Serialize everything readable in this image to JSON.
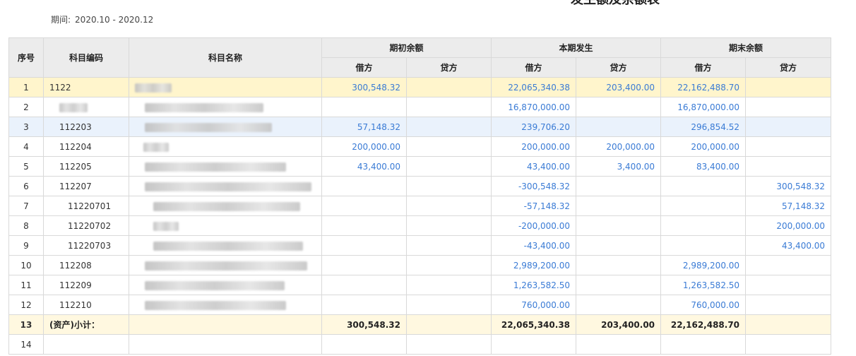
{
  "report": {
    "title": "发生额及余额表",
    "period_label": "期间:",
    "period_value": "2020.10 - 2020.12"
  },
  "columns": {
    "index": "序号",
    "code": "科目编码",
    "name": "科目名称",
    "groups": [
      "期初余额",
      "本期发生",
      "期末余额"
    ],
    "debit": "借方",
    "credit": "贷方"
  },
  "rows": [
    {
      "idx": "1",
      "code": "1122",
      "open_debit": "300,548.32",
      "open_credit": "",
      "period_debit": "22,065,340.38",
      "period_credit": "203,400.00",
      "close_debit": "22,162,488.70",
      "close_credit": ""
    },
    {
      "idx": "2",
      "code": "",
      "open_debit": "",
      "open_credit": "",
      "period_debit": "16,870,000.00",
      "period_credit": "",
      "close_debit": "16,870,000.00",
      "close_credit": ""
    },
    {
      "idx": "3",
      "code": "112203",
      "open_debit": "57,148.32",
      "open_credit": "",
      "period_debit": "239,706.20",
      "period_credit": "",
      "close_debit": "296,854.52",
      "close_credit": ""
    },
    {
      "idx": "4",
      "code": "112204",
      "open_debit": "200,000.00",
      "open_credit": "",
      "period_debit": "200,000.00",
      "period_credit": "200,000.00",
      "close_debit": "200,000.00",
      "close_credit": ""
    },
    {
      "idx": "5",
      "code": "112205",
      "open_debit": "43,400.00",
      "open_credit": "",
      "period_debit": "43,400.00",
      "period_credit": "3,400.00",
      "close_debit": "83,400.00",
      "close_credit": ""
    },
    {
      "idx": "6",
      "code": "112207",
      "open_debit": "",
      "open_credit": "",
      "period_debit": "-300,548.32",
      "period_credit": "",
      "close_debit": "",
      "close_credit": "300,548.32"
    },
    {
      "idx": "7",
      "code": "11220701",
      "open_debit": "",
      "open_credit": "",
      "period_debit": "-57,148.32",
      "period_credit": "",
      "close_debit": "",
      "close_credit": "57,148.32"
    },
    {
      "idx": "8",
      "code": "11220702",
      "open_debit": "",
      "open_credit": "",
      "period_debit": "-200,000.00",
      "period_credit": "",
      "close_debit": "",
      "close_credit": "200,000.00"
    },
    {
      "idx": "9",
      "code": "11220703",
      "open_debit": "",
      "open_credit": "",
      "period_debit": "-43,400.00",
      "period_credit": "",
      "close_debit": "",
      "close_credit": "43,400.00"
    },
    {
      "idx": "10",
      "code": "112208",
      "open_debit": "",
      "open_credit": "",
      "period_debit": "2,989,200.00",
      "period_credit": "",
      "close_debit": "2,989,200.00",
      "close_credit": ""
    },
    {
      "idx": "11",
      "code": "112209",
      "open_debit": "",
      "open_credit": "",
      "period_debit": "1,263,582.50",
      "period_credit": "",
      "close_debit": "1,263,582.50",
      "close_credit": ""
    },
    {
      "idx": "12",
      "code": "112210",
      "open_debit": "",
      "open_credit": "",
      "period_debit": "760,000.00",
      "period_credit": "",
      "close_debit": "760,000.00",
      "close_credit": ""
    },
    {
      "idx": "13",
      "code": "(资产)小计：",
      "open_debit": "300,548.32",
      "open_credit": "",
      "period_debit": "22,065,340.38",
      "period_credit": "203,400.00",
      "close_debit": "22,162,488.70",
      "close_credit": ""
    },
    {
      "idx": "14",
      "code": "",
      "open_debit": "",
      "open_credit": "",
      "period_debit": "",
      "period_credit": "",
      "close_debit": "",
      "close_credit": ""
    }
  ]
}
